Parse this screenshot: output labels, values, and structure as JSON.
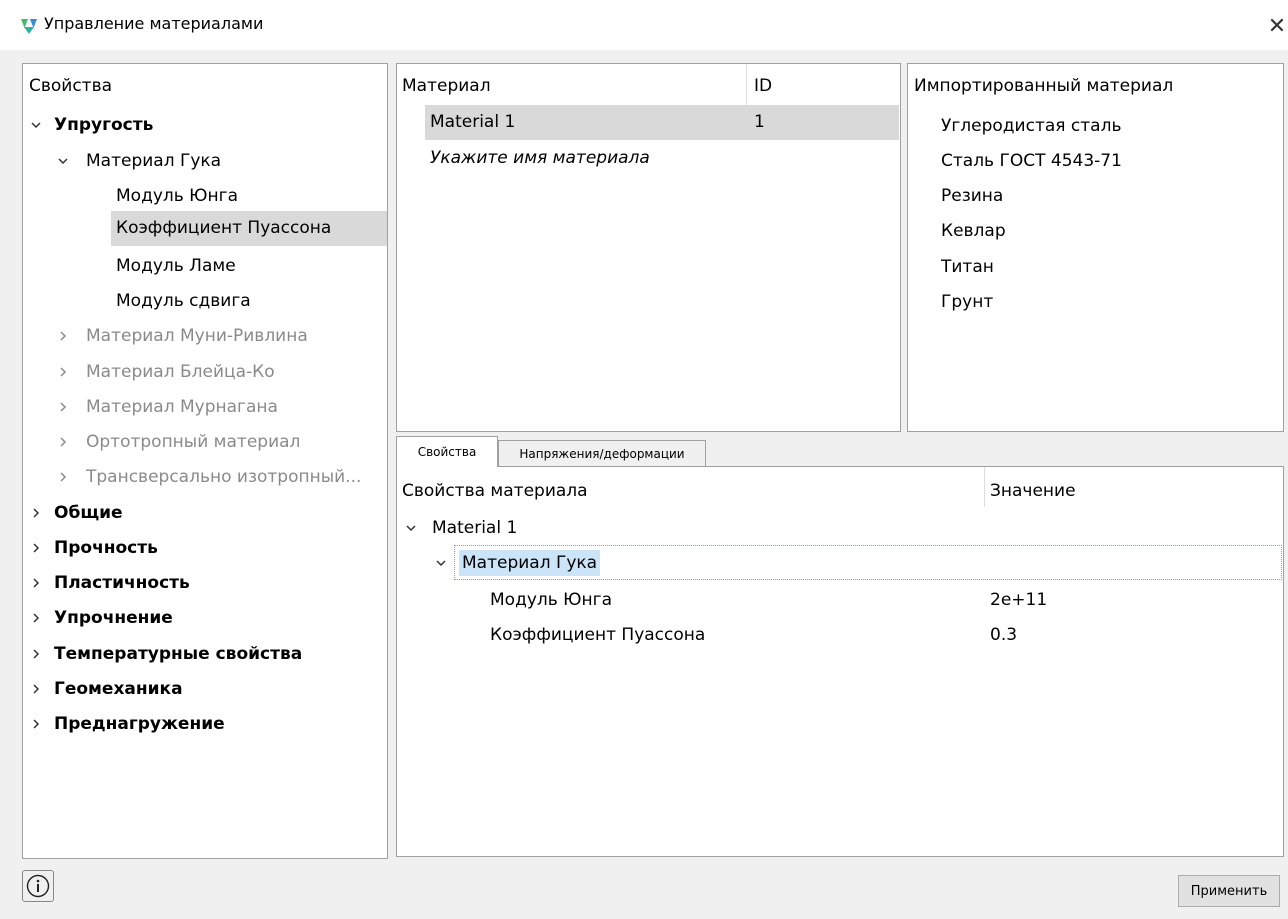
{
  "window": {
    "title": "Управление материалами"
  },
  "icons": {
    "app": "app-logo-icon",
    "close": "close-icon",
    "info": "info-icon",
    "expanded": "chevron-down-icon",
    "collapsed": "chevron-right-icon"
  },
  "properties": {
    "header": "Свойства",
    "items": [
      {
        "label": "Упругость",
        "state": "expanded",
        "style": "bold"
      },
      {
        "label": "Материал Гука",
        "state": "expanded",
        "style": "normal"
      },
      {
        "label": "Модуль Юнга",
        "state": "leaf",
        "style": "normal"
      },
      {
        "label": "Коэффициент Пуассона",
        "state": "leaf",
        "style": "normal",
        "selected": true
      },
      {
        "label": "Модуль Ламе",
        "state": "leaf",
        "style": "normal"
      },
      {
        "label": "Модуль сдвига",
        "state": "leaf",
        "style": "normal"
      },
      {
        "label": "Материал Муни-Ривлина",
        "state": "collapsed",
        "style": "gray"
      },
      {
        "label": "Материал Блейца-Ко",
        "state": "collapsed",
        "style": "gray"
      },
      {
        "label": "Материал Мурнагана",
        "state": "collapsed",
        "style": "gray"
      },
      {
        "label": "Ортотропный материал",
        "state": "collapsed",
        "style": "gray"
      },
      {
        "label": "Трансверсально изотропный...",
        "state": "collapsed",
        "style": "gray"
      },
      {
        "label": "Общие",
        "state": "collapsed",
        "style": "bold"
      },
      {
        "label": "Прочность",
        "state": "collapsed",
        "style": "bold"
      },
      {
        "label": "Пластичность",
        "state": "collapsed",
        "style": "bold"
      },
      {
        "label": "Упрочнение",
        "state": "collapsed",
        "style": "bold"
      },
      {
        "label": "Температурные свойства",
        "state": "collapsed",
        "style": "bold"
      },
      {
        "label": "Геомеханика",
        "state": "collapsed",
        "style": "bold"
      },
      {
        "label": "Преднагружение",
        "state": "collapsed",
        "style": "bold"
      }
    ]
  },
  "materials": {
    "columns": [
      "Материал",
      "ID"
    ],
    "rows": [
      {
        "name": "Material 1",
        "id": "1",
        "selected": true
      }
    ],
    "placeholder": "Укажите имя материала"
  },
  "imported": {
    "header": "Импортированный материал",
    "items": [
      "Углеродистая сталь",
      "Сталь ГОСТ 4543-71",
      "Резина",
      "Кевлар",
      "Титан",
      "Грунт"
    ]
  },
  "tabs": {
    "active": "Свойства",
    "other": "Напряжения/деформации"
  },
  "details": {
    "columns": [
      "Свойства материала",
      "Значение"
    ],
    "material": "Material 1",
    "group": "Материал Гука",
    "rows": [
      {
        "name": "Модуль Юнга",
        "value": "2e+11"
      },
      {
        "name": "Коэффициент Пуассона",
        "value": "0.3"
      }
    ]
  },
  "buttons": {
    "apply": "Применить"
  },
  "colors": {
    "selection": "#d9d9d9",
    "highlight": "#cce4f7",
    "focus_border": "#e28b48",
    "disabled_text": "#8a8a8a",
    "logo_green": "#3dbd6b",
    "logo_blue": "#2f8fd6"
  }
}
